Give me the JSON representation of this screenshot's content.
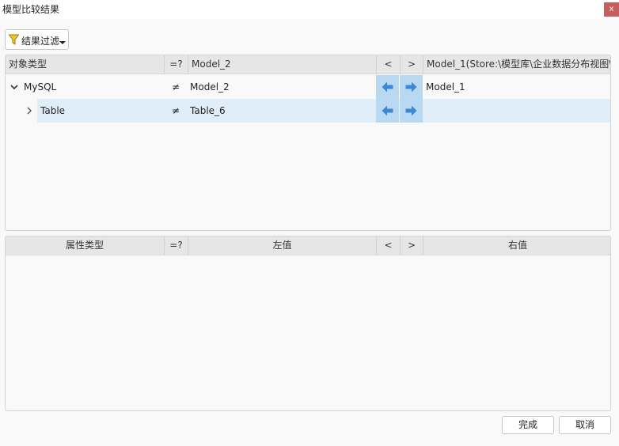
{
  "window": {
    "title": "模型比较结果",
    "close_label": "x"
  },
  "toolbar": {
    "filter_label": "结果过滤"
  },
  "compare_table": {
    "columns": {
      "object_type": "对象类型",
      "eq": "=?",
      "left_model": "Model_2",
      "copy_left": "<",
      "copy_right": ">",
      "right_model": "Model_1(Store:\\模型库\\企业数据分布视图\\"
    },
    "rows": [
      {
        "name": "MySQL",
        "eq": "≠",
        "left": "Model_2",
        "right": "Model_1"
      },
      {
        "name": "Table",
        "eq": "≠",
        "left": "Table_6",
        "right": ""
      }
    ]
  },
  "property_table": {
    "columns": {
      "property_type": "属性类型",
      "eq": "=?",
      "left_value": "左值",
      "copy_left": "<",
      "copy_right": ">",
      "right_value": "右值"
    }
  },
  "footer": {
    "finish_label": "完成",
    "cancel_label": "取消"
  },
  "colors": {
    "accent": "#4a90d9",
    "selected_row": "#e0eef9",
    "arrow_bg": "#b9d9f2",
    "close_bg": "#c85d5d"
  }
}
